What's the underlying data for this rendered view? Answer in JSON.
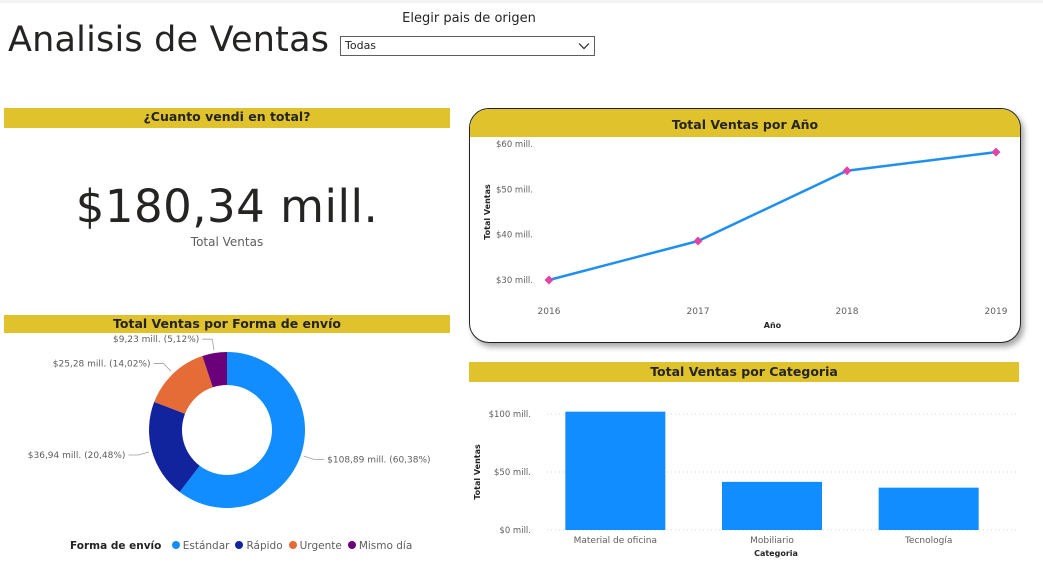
{
  "header": {
    "title": "Analisis de Ventas",
    "filter_label": "Elegir pais de origen",
    "filter_value": "Todas"
  },
  "kpi": {
    "title": "¿Cuanto vendi en total?",
    "value": "$180,34 mill.",
    "label": "Total Ventas"
  },
  "colors": {
    "band": "#e0c22d",
    "line": "#1f8ff0",
    "marker": "#e044a7",
    "bar": "#118dff"
  },
  "chart_data": [
    {
      "type": "line",
      "title": "Total Ventas por Año",
      "xlabel": "Año",
      "ylabel": "Total Ventas",
      "x": [
        "2016",
        "2017",
        "2018",
        "2019"
      ],
      "values": [
        30.0,
        38.6,
        54.1,
        58.2
      ],
      "yticks": [
        "$30 mill.",
        "$40 mill.",
        "$50 mill.",
        "$60 mill."
      ],
      "ytick_values": [
        30,
        40,
        50,
        60
      ],
      "ylim": [
        30,
        60
      ],
      "grid": false
    },
    {
      "type": "pie",
      "title": "Total Ventas por Forma de envío",
      "legend_title": "Forma de envío",
      "legend_position": "bottom",
      "slices": [
        {
          "name": "Estándar",
          "value": 108.89,
          "label": "$108,89 mill. (60,38%)",
          "color": "#118dff"
        },
        {
          "name": "Rápido",
          "value": 36.94,
          "label": "$36,94 mill. (20,48%)",
          "color": "#12239e"
        },
        {
          "name": "Urgente",
          "value": 25.28,
          "label": "$25,28 mill. (14,02%)",
          "color": "#e66c37"
        },
        {
          "name": "Mismo día",
          "value": 9.23,
          "label": "$9,23 mill. (5,12%)",
          "color": "#6b007b"
        }
      ]
    },
    {
      "type": "bar",
      "title": "Total Ventas por Categoria",
      "xlabel": "Categoria",
      "ylabel": "Total Ventas",
      "categories": [
        "Material de oficina",
        "Mobiliario",
        "Tecnología"
      ],
      "values": [
        102,
        41.5,
        36.5
      ],
      "yticks": [
        "$0 mill.",
        "$50 mill.",
        "$100 mill."
      ],
      "ytick_values": [
        0,
        50,
        100
      ],
      "ylim": [
        0,
        100
      ],
      "grid": true
    }
  ]
}
